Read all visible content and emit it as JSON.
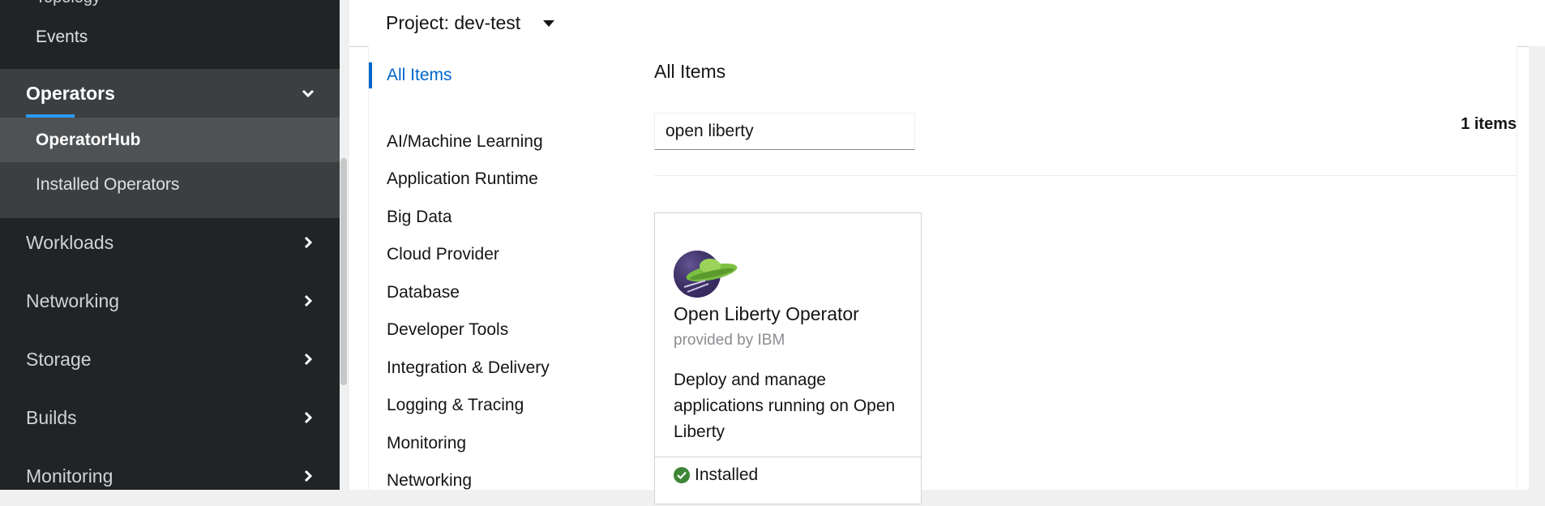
{
  "sidebar": {
    "cut_item": "Topology",
    "events": "Events",
    "operators": {
      "label": "Operators",
      "children": [
        "OperatorHub",
        "Installed Operators"
      ]
    },
    "groups": [
      "Workloads",
      "Networking",
      "Storage",
      "Builds",
      "Monitoring"
    ]
  },
  "header": {
    "project_label": "Project: dev-test"
  },
  "catalog": {
    "all_items_nav": "All Items",
    "categories": [
      "AI/Machine Learning",
      "Application Runtime",
      "Big Data",
      "Cloud Provider",
      "Database",
      "Developer Tools",
      "Integration & Delivery",
      "Logging & Tracing",
      "Monitoring",
      "Networking"
    ],
    "title": "All Items",
    "search_value": "open liberty",
    "count": "1 items",
    "tile": {
      "title": "Open Liberty Operator",
      "vendor": "provided by IBM",
      "description": "Deploy and manage applications running on Open Liberty",
      "status": "Installed"
    }
  },
  "colors": {
    "accent": "#2b9af3",
    "link": "#0066cc",
    "success": "#3e8635",
    "sidebar_bg": "#212427"
  }
}
